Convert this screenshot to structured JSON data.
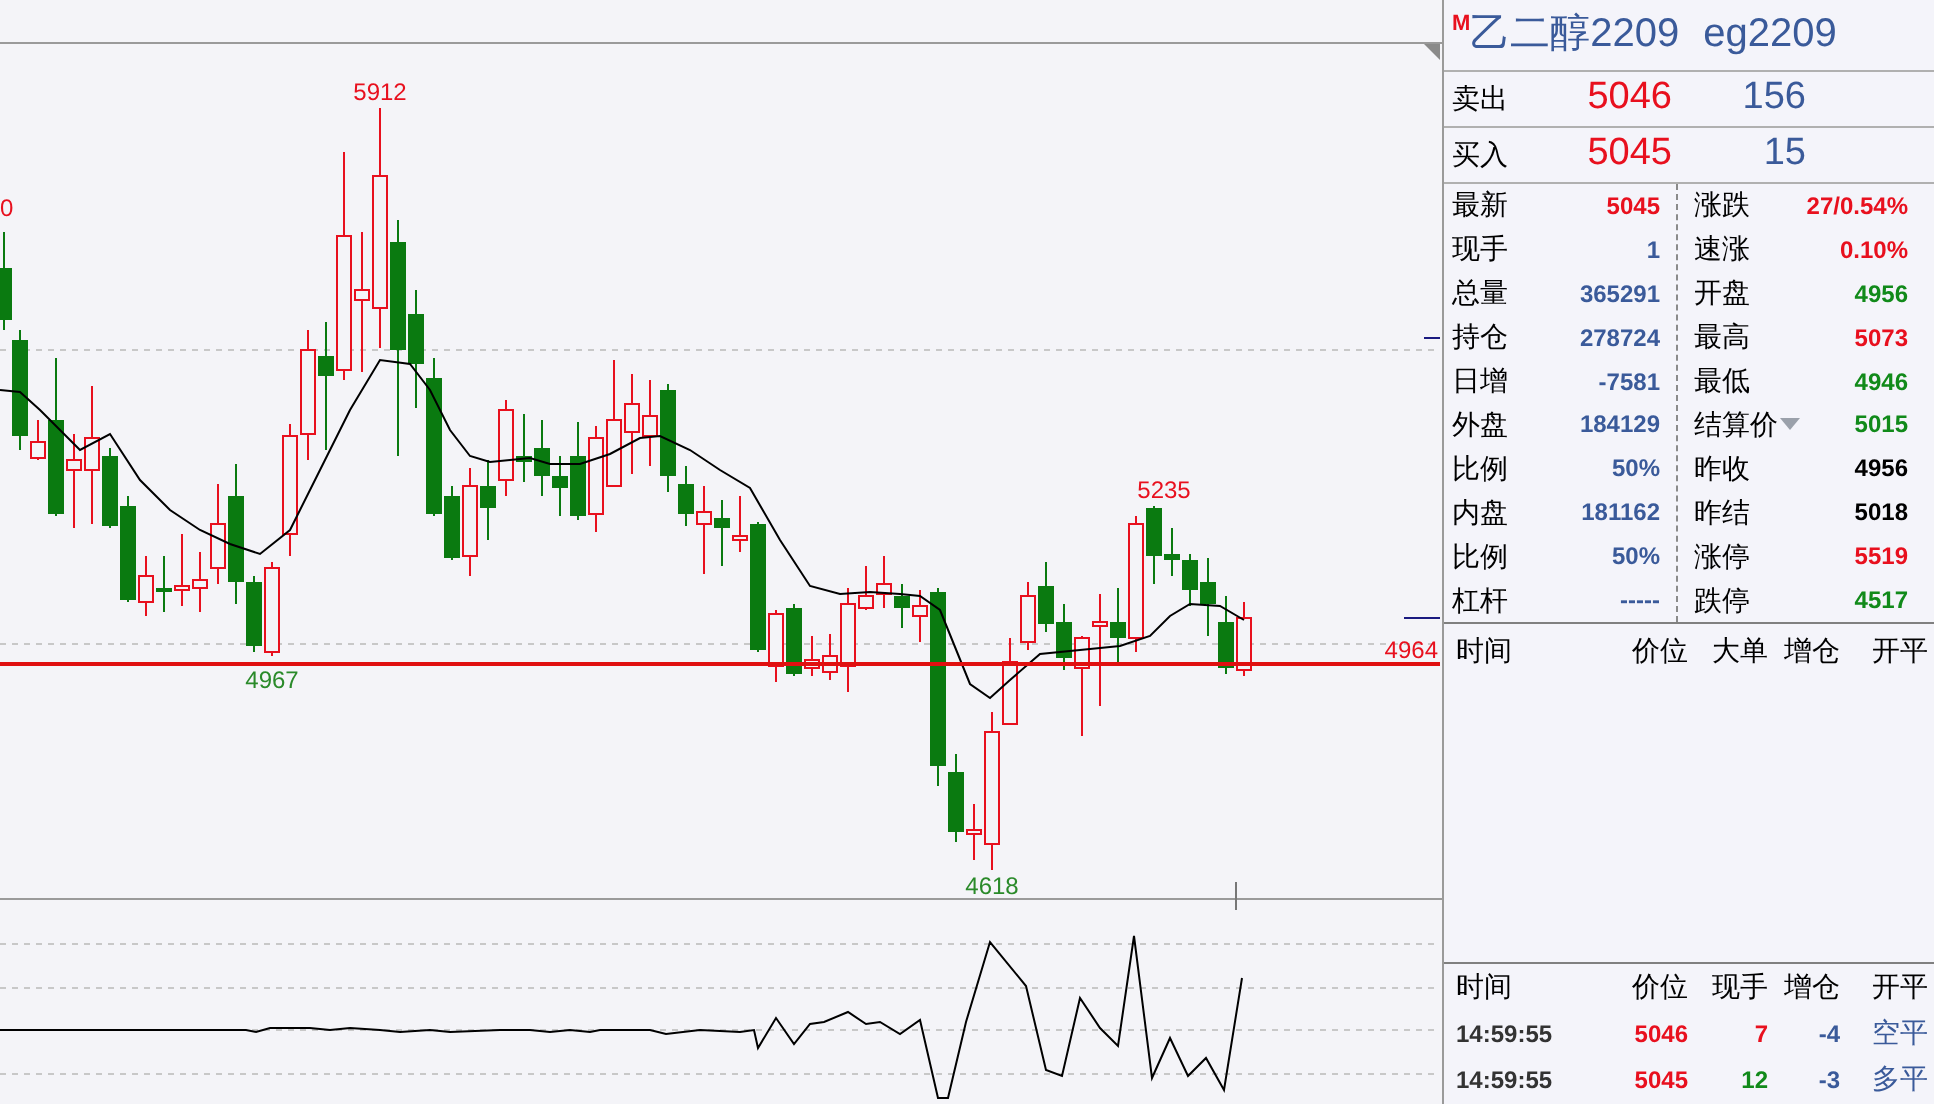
{
  "chart": {
    "labels": [
      {
        "text": "0",
        "color": "#e8101e"
      },
      {
        "text": "5912",
        "color": "#e8101e"
      },
      {
        "text": "4967",
        "color": "#2a8a2a"
      },
      {
        "text": "5235",
        "color": "#e8101e"
      },
      {
        "text": "4618",
        "color": "#2a8a2a"
      }
    ],
    "last_price_tag": "4964"
  },
  "quote_panel": {
    "flag": "M",
    "name": "乙二醇2209",
    "code": "eg2209",
    "quotes": [
      {
        "label": "卖出",
        "price": "5046",
        "volume": "156"
      },
      {
        "label": "买入",
        "price": "5045",
        "volume": "15"
      }
    ],
    "stats_left": [
      {
        "label": "最新",
        "value": "5045",
        "color": "#e8101e"
      },
      {
        "label": "现手",
        "value": "1",
        "color": "#3a5a9a"
      },
      {
        "label": "总量",
        "value": "365291",
        "color": "#3a5a9a"
      },
      {
        "label": "持仓",
        "value": "278724",
        "color": "#3a5a9a"
      },
      {
        "label": "日增",
        "value": "-7581",
        "color": "#3a5a9a"
      },
      {
        "label": "外盘",
        "value": "184129",
        "color": "#3a5a9a"
      },
      {
        "label": "比例",
        "value": "50%",
        "color": "#3a5a9a"
      },
      {
        "label": "内盘",
        "value": "181162",
        "color": "#3a5a9a"
      },
      {
        "label": "比例",
        "value": "50%",
        "color": "#3a5a9a"
      },
      {
        "label": "杠杆",
        "value": "-----",
        "color": "#3a5a9a"
      }
    ],
    "stats_right": [
      {
        "label": "涨跌",
        "value": "27/0.54%",
        "color": "#e8101e",
        "dropdown": false
      },
      {
        "label": "速涨",
        "value": "0.10%",
        "color": "#e8101e",
        "dropdown": false
      },
      {
        "label": "开盘",
        "value": "4956",
        "color": "#118a1a",
        "dropdown": false
      },
      {
        "label": "最高",
        "value": "5073",
        "color": "#e8101e",
        "dropdown": false
      },
      {
        "label": "最低",
        "value": "4946",
        "color": "#118a1a",
        "dropdown": false
      },
      {
        "label": "结算价",
        "value": "5015",
        "color": "#118a1a",
        "dropdown": true
      },
      {
        "label": "昨收",
        "value": "4956",
        "color": "#000000",
        "dropdown": false
      },
      {
        "label": "昨结",
        "value": "5018",
        "color": "#000000",
        "dropdown": false
      },
      {
        "label": "涨停",
        "value": "5519",
        "color": "#e8101e",
        "dropdown": false
      },
      {
        "label": "跌停",
        "value": "4517",
        "color": "#118a1a",
        "dropdown": false
      }
    ]
  },
  "big_orders": {
    "columns": [
      "时间",
      "价位",
      "大单",
      "增仓",
      "开平"
    ]
  },
  "ticks": {
    "columns": [
      "时间",
      "价位",
      "现手",
      "增仓",
      "开平"
    ],
    "rows": [
      {
        "time": "14:59:55",
        "price": "5046",
        "volume": "7",
        "color": "#e8101e",
        "oi_change": "-4",
        "open_close": "空平"
      },
      {
        "time": "14:59:55",
        "price": "5045",
        "volume": "12",
        "color": "#118a1a",
        "oi_change": "-3",
        "open_close": "多平"
      }
    ]
  }
}
